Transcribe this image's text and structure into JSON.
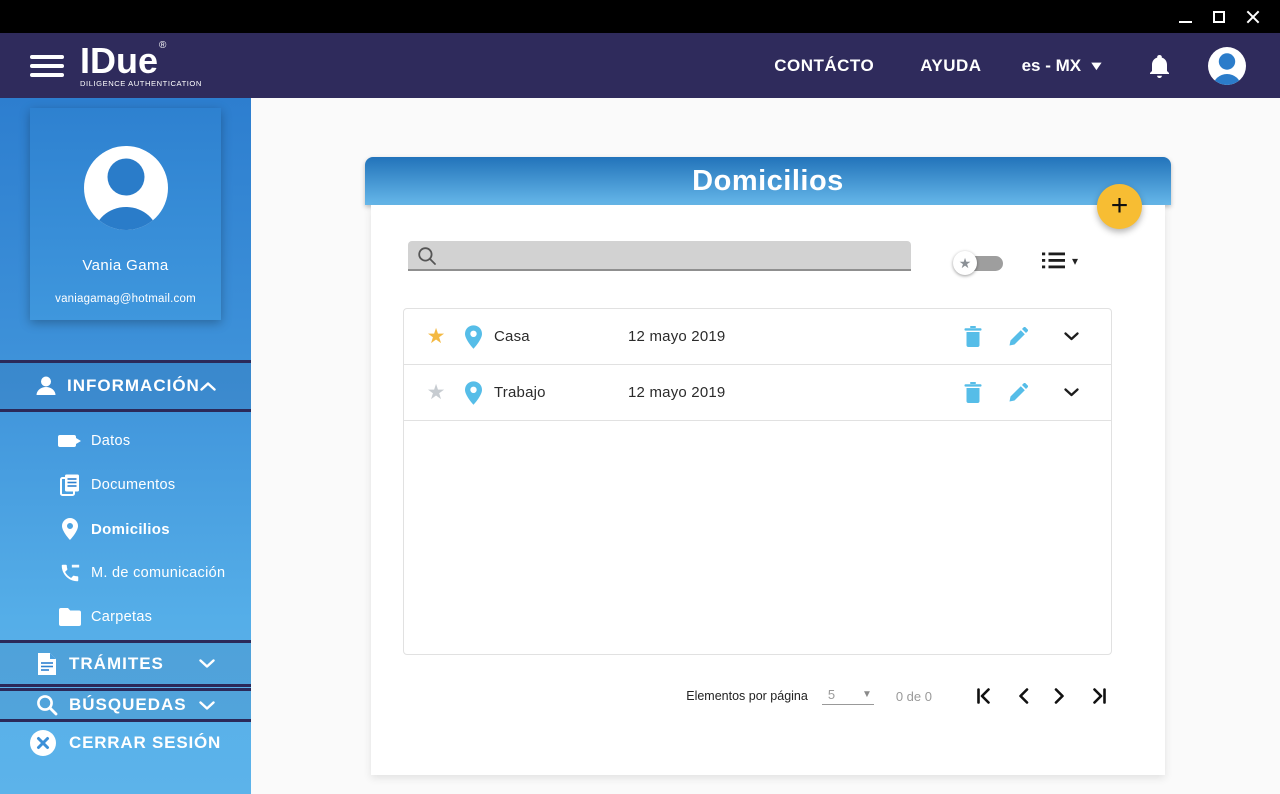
{
  "header": {
    "logo_title": "IDue",
    "logo_registered": "®",
    "logo_tagline": "DILIGENCE AUTHENTICATION",
    "nav_contacto": "CONTÁCTO",
    "nav_ayuda": "AYUDA",
    "language": "es - MX"
  },
  "sidebar": {
    "profile": {
      "name": "Vania Gama",
      "email": "vaniagamag@hotmail.com"
    },
    "section_informacion": "INFORMACIÓN",
    "items": [
      {
        "label": "Datos"
      },
      {
        "label": "Documentos"
      },
      {
        "label": "Domicilios",
        "active": true
      },
      {
        "label": "M. de comunicación"
      },
      {
        "label": "Carpetas"
      }
    ],
    "section_tramites": "TRÁMITES",
    "section_busquedas": "BÚSQUEDAS",
    "logout": "CERRAR SESIÓN"
  },
  "main": {
    "title": "Domicilios",
    "search_value": "",
    "rows": [
      {
        "name": "Casa",
        "date": "12 mayo 2019",
        "starred": true
      },
      {
        "name": "Trabajo",
        "date": "12 mayo 2019",
        "starred": false
      }
    ],
    "pagination": {
      "label": "Elementos por página",
      "page_size": "5",
      "range": "0 de 0"
    }
  },
  "icons": {
    "star": "★",
    "plus": "+",
    "triangle_down_small": "▾",
    "triangle_down": "▼"
  },
  "colors": {
    "header_navy": "#2f2b5c",
    "sidebar_top": "#2d7ecf",
    "sidebar_bottom": "#5cb3ea",
    "band_border_navy": "#2b2959",
    "card_header_top": "#2273ba",
    "card_header_bottom": "#66b7e9",
    "fab_yellow": "#f7bd33",
    "action_blue": "#56bde8",
    "star_yellow": "#f4b942",
    "star_gray": "#c7ccd1"
  }
}
